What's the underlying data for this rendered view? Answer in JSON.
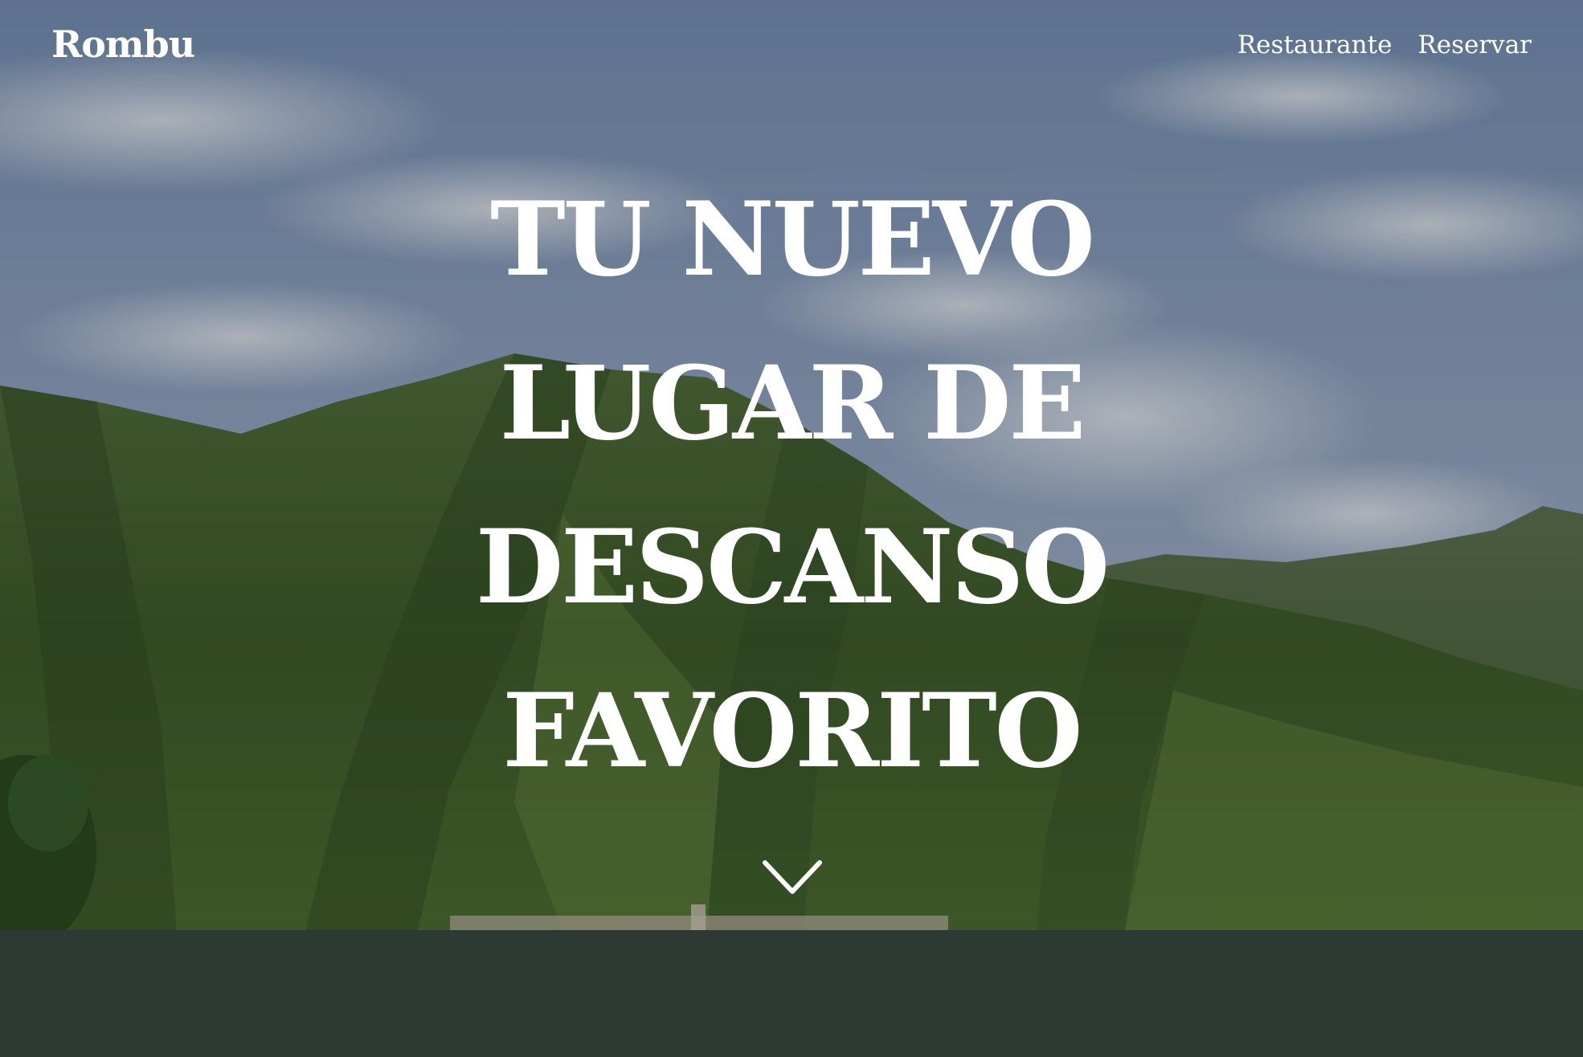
{
  "nav": {
    "brand": "Rombu",
    "links": [
      "Restaurante",
      "Reservar"
    ]
  },
  "hero": {
    "headline_lines": [
      "TU NUEVO",
      "LUGAR DE",
      "DESCANSO",
      "FAVORITO"
    ],
    "scroll_icon": "chevron-down-icon",
    "background_image": "mountain landscape with cloudy blue sky"
  },
  "colors": {
    "sky_top": "#7d93b3",
    "sky_bottom": "#aab7c6",
    "mountain_dark": "#2f4a27",
    "mountain_mid": "#4d6b35",
    "mountain_light": "#6f8a45",
    "band": "#2d3a33",
    "text": "#ffffff"
  }
}
